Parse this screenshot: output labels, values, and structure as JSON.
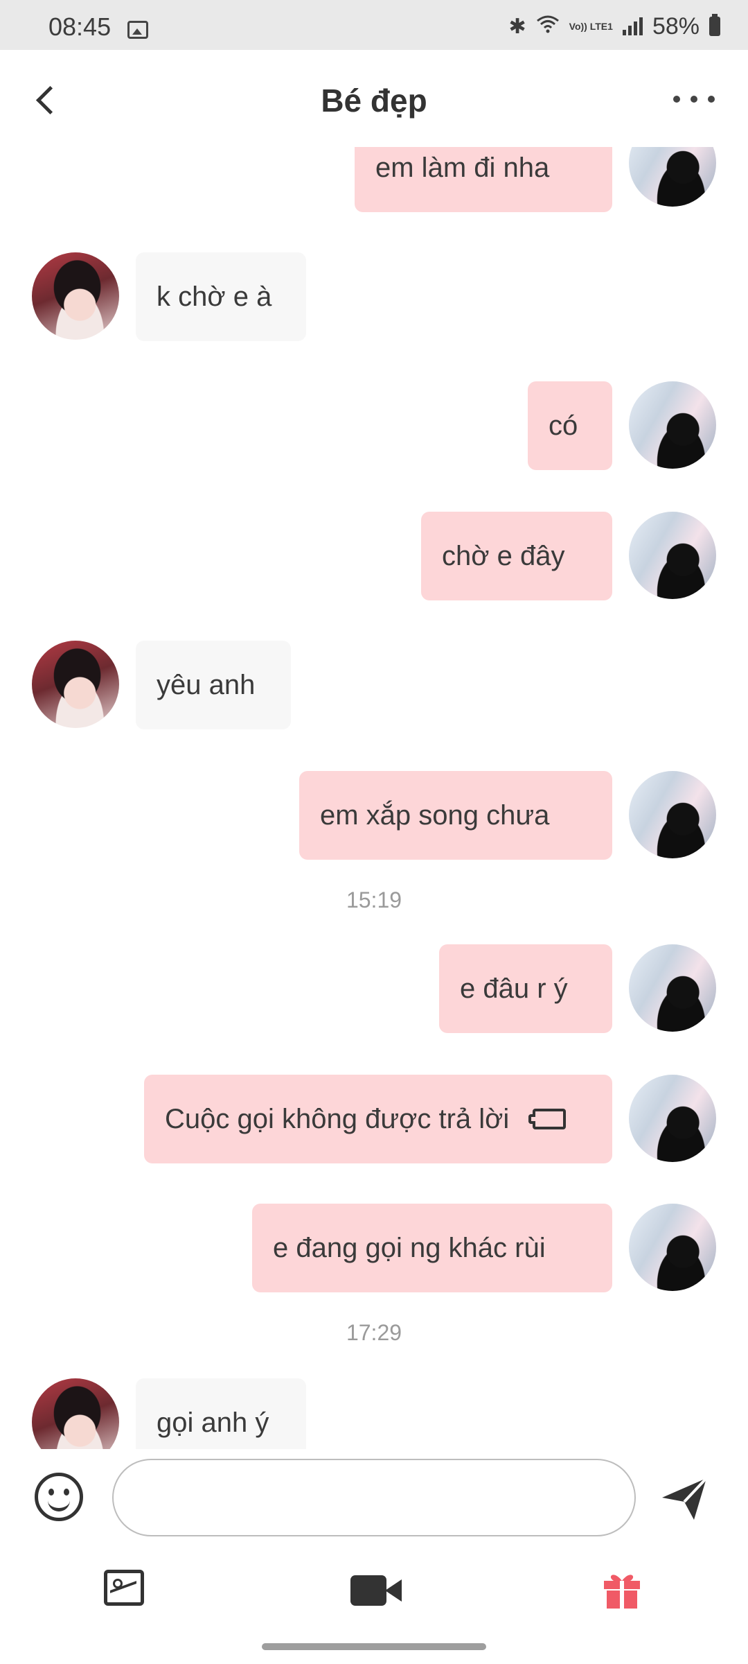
{
  "status_bar": {
    "time": "08:45",
    "battery": "58%",
    "volte": "Vo)) LTE1"
  },
  "header": {
    "title": "Bé đẹp"
  },
  "messages": [
    {
      "from": "me",
      "text": "em làm đi nha"
    },
    {
      "from": "her",
      "text": "k chờ e à"
    },
    {
      "from": "me",
      "text": "có"
    },
    {
      "from": "me",
      "text": "chờ e đây"
    },
    {
      "from": "her",
      "text": "yêu anh"
    },
    {
      "from": "me",
      "text": "em xắp song chưa"
    },
    {
      "from": "me",
      "text": "e đâu r ý"
    },
    {
      "from": "me",
      "text": "Cuộc gọi không được trả lời",
      "type": "missed-call"
    },
    {
      "from": "me",
      "text": "e đang gọi ng khác rùi"
    },
    {
      "from": "her",
      "text": "gọi anh ý"
    }
  ],
  "timestamps": [
    "15:19",
    "17:29"
  ],
  "composer": {
    "placeholder": ""
  },
  "colors": {
    "my_bubble": "#fdd6d8",
    "her_bubble": "#f7f7f7",
    "gift": "#f05a66"
  },
  "icons": [
    "back-icon",
    "more-icon",
    "emoji-icon",
    "send-icon",
    "image-icon",
    "video-icon",
    "gift-icon"
  ]
}
